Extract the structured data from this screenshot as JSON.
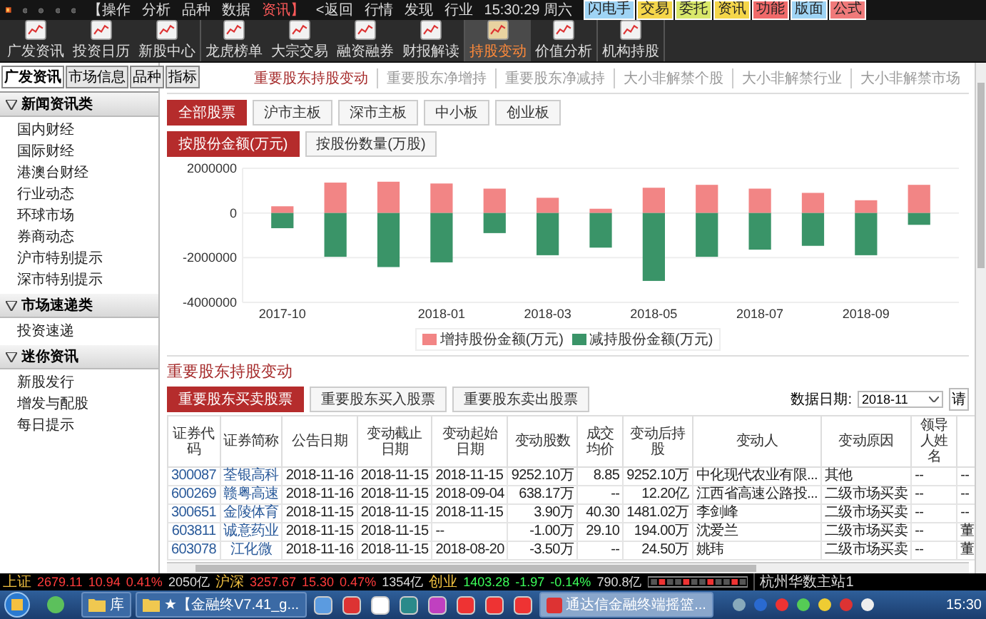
{
  "menu_bar": {
    "items": [
      {
        "label": "【操作",
        "selected": false
      },
      {
        "label": "分析",
        "selected": false
      },
      {
        "label": "品种",
        "selected": false
      },
      {
        "label": "数据",
        "selected": false
      },
      {
        "label": "资讯】",
        "selected": true
      },
      {
        "label": "<返回",
        "selected": false
      },
      {
        "label": "行情",
        "selected": false
      },
      {
        "label": "发现",
        "selected": false
      },
      {
        "label": "行业",
        "selected": false
      }
    ],
    "clock": "15:30:29 周六",
    "quick_buttons": [
      {
        "label": "闪电手",
        "color": "#9fd4f5"
      },
      {
        "label": "交易",
        "color": "#f5d64a"
      },
      {
        "label": "委托",
        "color": "#d9e86a"
      },
      {
        "label": "资讯",
        "color": "#f5d64a"
      },
      {
        "label": "功能",
        "color": "#f06a6a"
      },
      {
        "label": "版面",
        "color": "#9fd4f5"
      },
      {
        "label": "公式",
        "color": "#f07a7a"
      }
    ]
  },
  "toolbar": {
    "groups": [
      [
        {
          "label": "广发资讯",
          "selected": false
        },
        {
          "label": "投资日历",
          "selected": false
        },
        {
          "label": "新股中心",
          "selected": false
        }
      ],
      [
        {
          "label": "龙虎榜单",
          "selected": false
        },
        {
          "label": "大宗交易",
          "selected": false
        },
        {
          "label": "融资融券",
          "selected": false
        },
        {
          "label": "财报解读",
          "selected": false
        }
      ],
      [
        {
          "label": "持股变动",
          "selected": true
        },
        {
          "label": "价值分析",
          "selected": false
        }
      ],
      [
        {
          "label": "机构持股",
          "selected": false
        }
      ]
    ]
  },
  "sidebar": {
    "tabs": [
      {
        "label": "广发资讯",
        "selected": true
      },
      {
        "label": "市场信息",
        "selected": false
      },
      {
        "label": "品种",
        "selected": false
      },
      {
        "label": "指标",
        "selected": false
      }
    ],
    "sections": [
      {
        "title": "新闻资讯类",
        "expanded": true,
        "items": [
          "国内财经",
          "国际财经",
          "港澳台财经",
          "行业动态",
          "环球市场",
          "券商动态",
          "沪市特别提示",
          "深市特别提示"
        ]
      },
      {
        "title": "市场速递类",
        "expanded": true,
        "items": [
          "投资速递"
        ]
      },
      {
        "title": "迷你资讯",
        "expanded": true,
        "items": [
          "新股发行",
          "增发与配股",
          "每日提示"
        ]
      }
    ]
  },
  "content": {
    "report_tabs": [
      {
        "label": "重要股东持股变动",
        "selected": true
      },
      {
        "label": "重要股东净增持",
        "selected": false
      },
      {
        "label": "重要股东净减持",
        "selected": false
      },
      {
        "label": "大小非解禁个股",
        "selected": false
      },
      {
        "label": "大小非解禁行业",
        "selected": false
      },
      {
        "label": "大小非解禁市场",
        "selected": false
      }
    ],
    "board_filters": [
      {
        "label": "全部股票",
        "selected": true
      },
      {
        "label": "沪市主板",
        "selected": false
      },
      {
        "label": "深市主板",
        "selected": false
      },
      {
        "label": "中小板",
        "selected": false
      },
      {
        "label": "创业板",
        "selected": false
      }
    ],
    "measure_filters": [
      {
        "label": "按股份金额(万元)",
        "selected": true
      },
      {
        "label": "按股份数量(万股)",
        "selected": false
      }
    ],
    "chart_data": {
      "type": "bar",
      "stacked": true,
      "categories": [
        "2017-10",
        null,
        null,
        "2018-01",
        null,
        "2018-03",
        null,
        "2018-05",
        null,
        "2018-07",
        null,
        "2018-09",
        null
      ],
      "series": [
        {
          "name": "增持股份金额(万元)",
          "color": "#f28585",
          "values": [
            300000,
            1360000,
            1400000,
            1320000,
            1090000,
            680000,
            190000,
            1130000,
            1260000,
            1090000,
            900000,
            570000,
            1260000
          ]
        },
        {
          "name": "减持股份金额(万元)",
          "color": "#3a9468",
          "values": [
            -680000,
            -1960000,
            -2420000,
            -2210000,
            -900000,
            -1890000,
            -1550000,
            -3040000,
            -1960000,
            -1640000,
            -1470000,
            -1890000,
            -530000
          ]
        }
      ],
      "legend": "bottom",
      "ylim": [
        -4000000,
        2000000
      ],
      "yticks": [
        -4000000,
        -2000000,
        0,
        2000000
      ]
    },
    "table_title": "重要股东持股变动",
    "table_filters": [
      {
        "label": "重要股东买卖股票",
        "selected": true
      },
      {
        "label": "重要股东买入股票",
        "selected": false
      },
      {
        "label": "重要股东卖出股票",
        "selected": false
      }
    ],
    "date_filter": {
      "label": "数据日期:",
      "value": "2018-11"
    },
    "query_button": "请",
    "table": {
      "columns": [
        "证券代码",
        "证券简称",
        "公告日期",
        "变动截止日期",
        "变动起始日期",
        "变动股数",
        "成交均价",
        "变动后持股",
        "变动人",
        "变动原因",
        "领导人姓名"
      ],
      "rows": [
        [
          "300087",
          "荃银高科",
          "2018-11-16",
          "2018-11-15",
          "2018-11-15",
          "9252.10万",
          "8.85",
          "9252.10万",
          "中化现代农业有限...",
          "其他",
          "--",
          "--"
        ],
        [
          "600269",
          "赣粤高速",
          "2018-11-16",
          "2018-11-15",
          "2018-09-04",
          "638.17万",
          "--",
          "12.20亿",
          "江西省高速公路投...",
          "二级市场买卖",
          "--",
          "--"
        ],
        [
          "300651",
          "金陵体育",
          "2018-11-15",
          "2018-11-15",
          "2018-11-15",
          "3.90万",
          "40.30",
          "1481.02万",
          "李剑峰",
          "二级市场买卖",
          "--",
          "--"
        ],
        [
          "603811",
          "诚意药业",
          "2018-11-15",
          "2018-11-15",
          "--",
          "-1.00万",
          "29.10",
          "194.00万",
          "沈爱兰",
          "二级市场买卖",
          "--",
          "董"
        ],
        [
          "603078",
          "江化微",
          "2018-11-16",
          "2018-11-15",
          "2018-08-20",
          "-3.50万",
          "--",
          "24.50万",
          "姚玮",
          "二级市场买卖",
          "--",
          "董"
        ]
      ]
    }
  },
  "status_bar": {
    "indices": [
      {
        "name": "上证",
        "value": "2679.11",
        "change": "10.94",
        "percent": "0.41%",
        "turnover": "2050亿",
        "rising": true
      },
      {
        "name": "沪深",
        "value": "3257.67",
        "change": "15.30",
        "percent": "0.47%",
        "turnover": "1354亿",
        "rising": true
      },
      {
        "name": "创业",
        "value": "1403.28",
        "change": "-1.97",
        "percent": "-0.14%",
        "turnover": "790.8亿",
        "rising": false
      }
    ],
    "server": "杭州华数主站1"
  },
  "taskbar": {
    "windows": [
      {
        "label": "库",
        "selected": false
      },
      {
        "label": "★【金融终V7.41_g...",
        "selected": false
      },
      {
        "label": "通达信金融终端摇篮...",
        "selected": true
      }
    ],
    "clock": "15:30"
  }
}
